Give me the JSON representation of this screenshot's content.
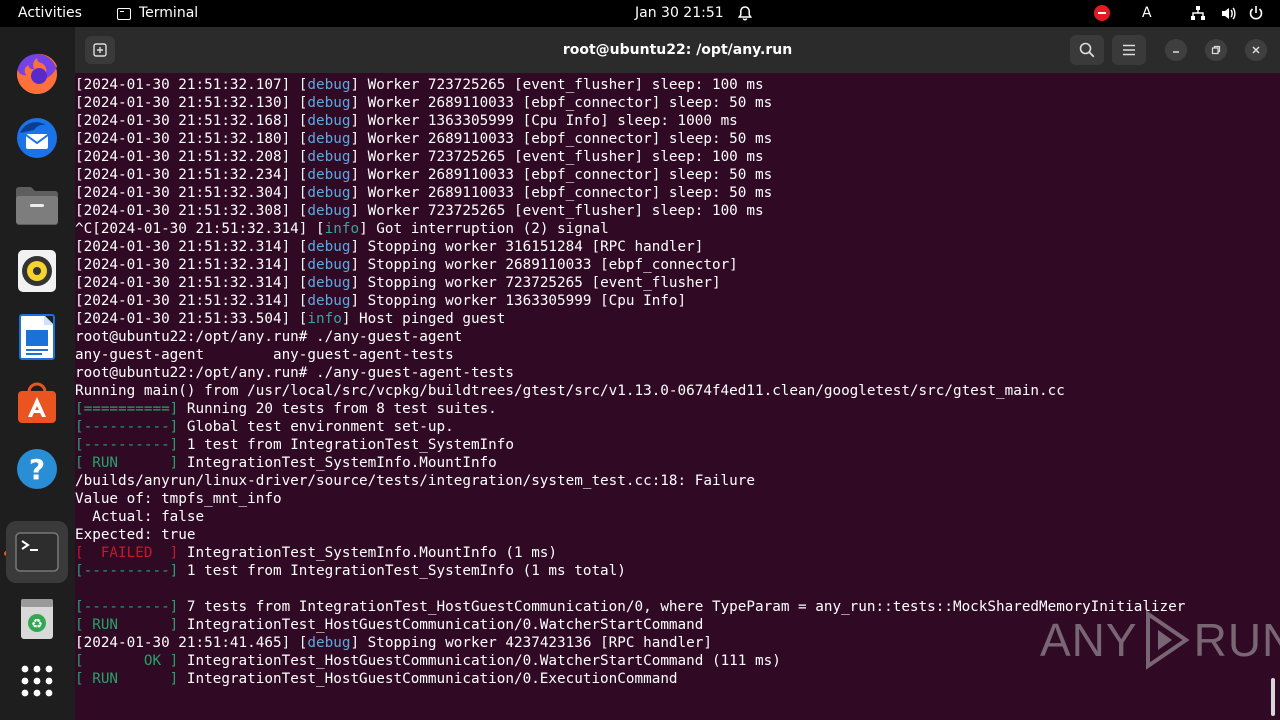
{
  "topbar": {
    "activities": "Activities",
    "app_name": "Terminal",
    "clock": "Jan 30  21:51",
    "input_indicator": "A"
  },
  "dock": {
    "items": [
      {
        "name": "firefox-icon",
        "color": "#ff7139"
      },
      {
        "name": "thunderbird-icon",
        "color": "#1a73e8"
      },
      {
        "name": "files-icon",
        "color": "#8a8a8a"
      },
      {
        "name": "rhythmbox-icon",
        "color": "#f6d32d"
      },
      {
        "name": "libreoffice-writer-icon",
        "color": "#1c71d8"
      },
      {
        "name": "app-center-icon",
        "color": "#e95420"
      },
      {
        "name": "help-icon",
        "color": "#2a8ed6"
      },
      {
        "name": "terminal-icon",
        "color": "#2d2d2d"
      },
      {
        "name": "trash-icon",
        "color": "#c0c0c0"
      },
      {
        "name": "show-apps-icon",
        "color": "#ffffff"
      }
    ]
  },
  "window": {
    "title": "root@ubuntu22: /opt/any.run"
  },
  "terminal": {
    "lines": [
      [
        {
          "t": "[2024-01-30 21:51:32.107] ["
        },
        {
          "t": "debug",
          "c": "debug"
        },
        {
          "t": "] Worker 723725265 [event_flusher] sleep: 100 ms"
        }
      ],
      [
        {
          "t": "[2024-01-30 21:51:32.130] ["
        },
        {
          "t": "debug",
          "c": "debug"
        },
        {
          "t": "] Worker 2689110033 [ebpf_connector] sleep: 50 ms"
        }
      ],
      [
        {
          "t": "[2024-01-30 21:51:32.168] ["
        },
        {
          "t": "debug",
          "c": "debug"
        },
        {
          "t": "] Worker 1363305999 [Cpu Info] sleep: 1000 ms"
        }
      ],
      [
        {
          "t": "[2024-01-30 21:51:32.180] ["
        },
        {
          "t": "debug",
          "c": "debug"
        },
        {
          "t": "] Worker 2689110033 [ebpf_connector] sleep: 50 ms"
        }
      ],
      [
        {
          "t": "[2024-01-30 21:51:32.208] ["
        },
        {
          "t": "debug",
          "c": "debug"
        },
        {
          "t": "] Worker 723725265 [event_flusher] sleep: 100 ms"
        }
      ],
      [
        {
          "t": "[2024-01-30 21:51:32.234] ["
        },
        {
          "t": "debug",
          "c": "debug"
        },
        {
          "t": "] Worker 2689110033 [ebpf_connector] sleep: 50 ms"
        }
      ],
      [
        {
          "t": "[2024-01-30 21:51:32.304] ["
        },
        {
          "t": "debug",
          "c": "debug"
        },
        {
          "t": "] Worker 2689110033 [ebpf_connector] sleep: 50 ms"
        }
      ],
      [
        {
          "t": "[2024-01-30 21:51:32.308] ["
        },
        {
          "t": "debug",
          "c": "debug"
        },
        {
          "t": "] Worker 723725265 [event_flusher] sleep: 100 ms"
        }
      ],
      [
        {
          "t": "^C[2024-01-30 21:51:32.314] ["
        },
        {
          "t": "info",
          "c": "info"
        },
        {
          "t": "] Got interruption (2) signal"
        }
      ],
      [
        {
          "t": "[2024-01-30 21:51:32.314] ["
        },
        {
          "t": "debug",
          "c": "debug"
        },
        {
          "t": "] Stopping worker 316151284 [RPC handler]"
        }
      ],
      [
        {
          "t": "[2024-01-30 21:51:32.314] ["
        },
        {
          "t": "debug",
          "c": "debug"
        },
        {
          "t": "] Stopping worker 2689110033 [ebpf_connector]"
        }
      ],
      [
        {
          "t": "[2024-01-30 21:51:32.314] ["
        },
        {
          "t": "debug",
          "c": "debug"
        },
        {
          "t": "] Stopping worker 723725265 [event_flusher]"
        }
      ],
      [
        {
          "t": "[2024-01-30 21:51:32.314] ["
        },
        {
          "t": "debug",
          "c": "debug"
        },
        {
          "t": "] Stopping worker 1363305999 [Cpu Info]"
        }
      ],
      [
        {
          "t": "[2024-01-30 21:51:33.504] ["
        },
        {
          "t": "info",
          "c": "info"
        },
        {
          "t": "] Host pinged guest"
        }
      ],
      [
        {
          "t": "root@ubuntu22:/opt/any.run# ./any-guest-agent"
        }
      ],
      [
        {
          "t": "any-guest-agent        any-guest-agent-tests"
        }
      ],
      [
        {
          "t": "root@ubuntu22:/opt/any.run# ./any-guest-agent-tests"
        }
      ],
      [
        {
          "t": "Running main() from /usr/local/src/vcpkg/buildtrees/gtest/src/v1.13.0-0674f4ed11.clean/googletest/src/gtest_main.cc"
        }
      ],
      [
        {
          "t": "[==========]",
          "c": "green"
        },
        {
          "t": " Running 20 tests from 8 test suites."
        }
      ],
      [
        {
          "t": "[----------]",
          "c": "green"
        },
        {
          "t": " Global test environment set-up."
        }
      ],
      [
        {
          "t": "[----------]",
          "c": "green"
        },
        {
          "t": " 1 test from IntegrationTest_SystemInfo"
        }
      ],
      [
        {
          "t": "[ RUN      ]",
          "c": "green"
        },
        {
          "t": " IntegrationTest_SystemInfo.MountInfo"
        }
      ],
      [
        {
          "t": "/builds/anyrun/linux-driver/source/tests/integration/system_test.cc:18: Failure"
        }
      ],
      [
        {
          "t": "Value of: tmpfs_mnt_info"
        }
      ],
      [
        {
          "t": "  Actual: false"
        }
      ],
      [
        {
          "t": "Expected: true"
        }
      ],
      [
        {
          "t": "[  FAILED  ]",
          "c": "red"
        },
        {
          "t": " IntegrationTest_SystemInfo.MountInfo (1 ms)"
        }
      ],
      [
        {
          "t": "[----------]",
          "c": "green"
        },
        {
          "t": " 1 test from IntegrationTest_SystemInfo (1 ms total)"
        }
      ],
      [
        {
          "t": ""
        }
      ],
      [
        {
          "t": "[----------]",
          "c": "green"
        },
        {
          "t": " 7 tests from IntegrationTest_HostGuestCommunication/0, where TypeParam = any_run::tests::MockSharedMemoryInitializer"
        }
      ],
      [
        {
          "t": "[ RUN      ]",
          "c": "green"
        },
        {
          "t": " IntegrationTest_HostGuestCommunication/0.WatcherStartCommand"
        }
      ],
      [
        {
          "t": "[2024-01-30 21:51:41.465] ["
        },
        {
          "t": "debug",
          "c": "debug"
        },
        {
          "t": "] Stopping worker 4237423136 [RPC handler]"
        }
      ],
      [
        {
          "t": "[       OK ]",
          "c": "green"
        },
        {
          "t": " IntegrationTest_HostGuestCommunication/0.WatcherStartCommand (111 ms)"
        }
      ],
      [
        {
          "t": "[ RUN      ]",
          "c": "green"
        },
        {
          "t": " IntegrationTest_HostGuestCommunication/0.ExecutionCommand"
        }
      ]
    ]
  },
  "watermark": {
    "left": "ANY",
    "right": "RUN"
  },
  "colors": {
    "terminal_bg": "#300a24",
    "debug": "#5ea8e0",
    "info": "#36a5a0",
    "ok": "#26a269",
    "failed": "#c01c28",
    "accent": "#e95420"
  }
}
